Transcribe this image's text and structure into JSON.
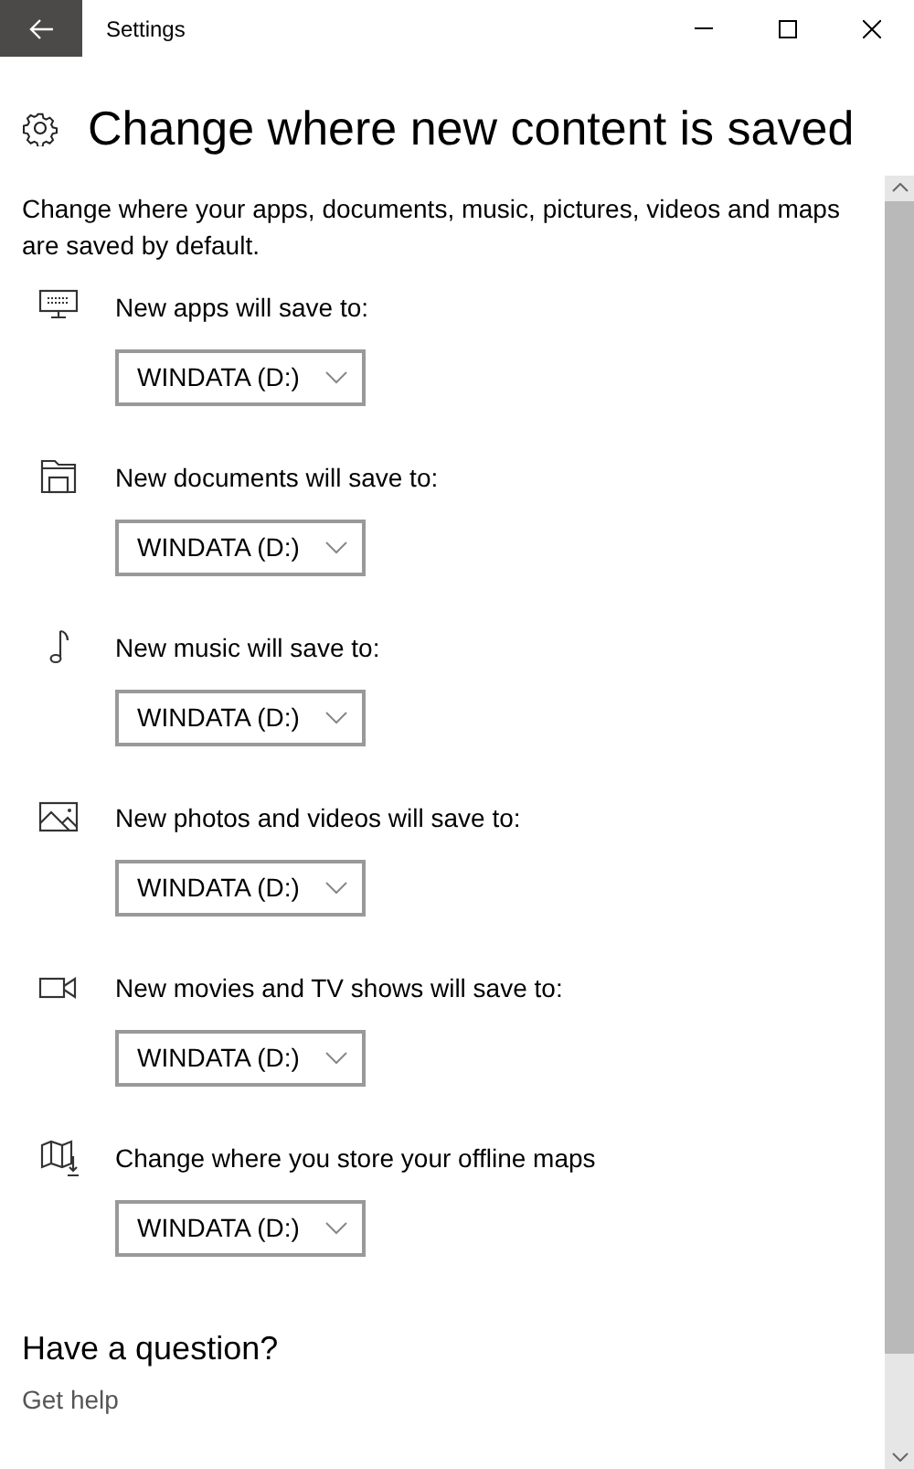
{
  "window": {
    "title": "Settings"
  },
  "page": {
    "title": "Change where new content is saved",
    "description": "Change where your apps, documents, music, pictures, videos and maps are saved by default."
  },
  "locations": [
    {
      "kind": "apps",
      "label": "New apps will save to:",
      "value": "WINDATA (D:)"
    },
    {
      "kind": "documents",
      "label": "New documents will save to:",
      "value": "WINDATA (D:)"
    },
    {
      "kind": "music",
      "label": "New music will save to:",
      "value": "WINDATA (D:)"
    },
    {
      "kind": "photos",
      "label": "New photos and videos will save to:",
      "value": "WINDATA (D:)"
    },
    {
      "kind": "movies",
      "label": "New movies and TV shows will save to:",
      "value": "WINDATA (D:)"
    },
    {
      "kind": "maps",
      "label": "Change where you store your offline maps",
      "value": "WINDATA (D:)"
    }
  ],
  "help": {
    "title": "Have a question?",
    "link": "Get help"
  }
}
